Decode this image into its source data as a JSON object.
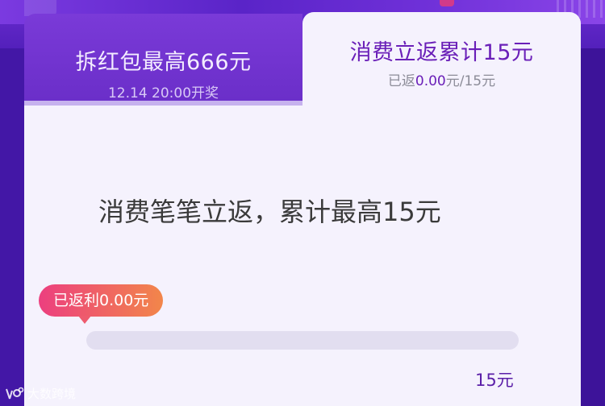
{
  "tabs": {
    "left": {
      "title": "拆红包最高666元",
      "subtitle": "12.14 20:00开奖"
    },
    "right": {
      "title": "消费立返累计15元",
      "returned_prefix": "已返",
      "returned_amount": "0.00",
      "returned_suffix": "元/15元"
    }
  },
  "main": {
    "headline": "消费笔笔立返，累计最高15元",
    "bubble_label": "已返利0.00元",
    "progress_fraction": 0.0,
    "goal_label": "15元"
  },
  "watermark": {
    "text": "大数跨境"
  },
  "colors": {
    "accent_purple": "#6a1fb8",
    "bubble_start": "#ec3f7f",
    "bubble_end": "#f2864a"
  }
}
